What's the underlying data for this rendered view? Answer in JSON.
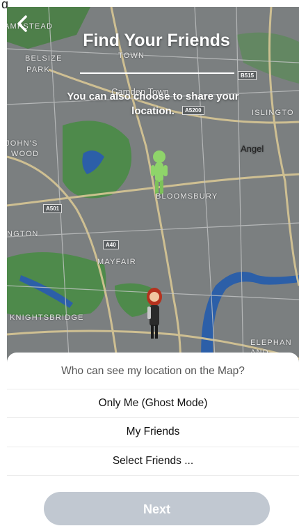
{
  "partial_char": "g",
  "header": {
    "title": "Find Your Friends",
    "subtitle": "You can also choose to share your location.",
    "back_icon": "chevron-left-icon"
  },
  "map": {
    "labels": [
      "AMPSTEAD",
      "BELSIZE",
      "PARK",
      "TOWN",
      "Camden Town",
      "ISLINGTO",
      "JOHN'S",
      "WOOD",
      "Angel",
      "BLOOMSBURY",
      "NGTON",
      "MAYFAIR",
      "KNIGHTSBRIDGE",
      "ELEPHAN",
      "AND CASTL"
    ],
    "road_badges": [
      "B515",
      "A5200",
      "A501",
      "A40"
    ],
    "avatars": [
      "friend-bitmoji",
      "user-bitmoji"
    ]
  },
  "sheet": {
    "question": "Who can see my location on the Map?",
    "options": [
      "Only Me (Ghost Mode)",
      "My Friends",
      "Select Friends ..."
    ],
    "next_label": "Next"
  },
  "colors": {
    "map_base": "#7b7f80",
    "park": "#4e8a4b",
    "water": "#2c5fa8",
    "road": "#d8c795",
    "next_button": "#c1c8d1"
  }
}
